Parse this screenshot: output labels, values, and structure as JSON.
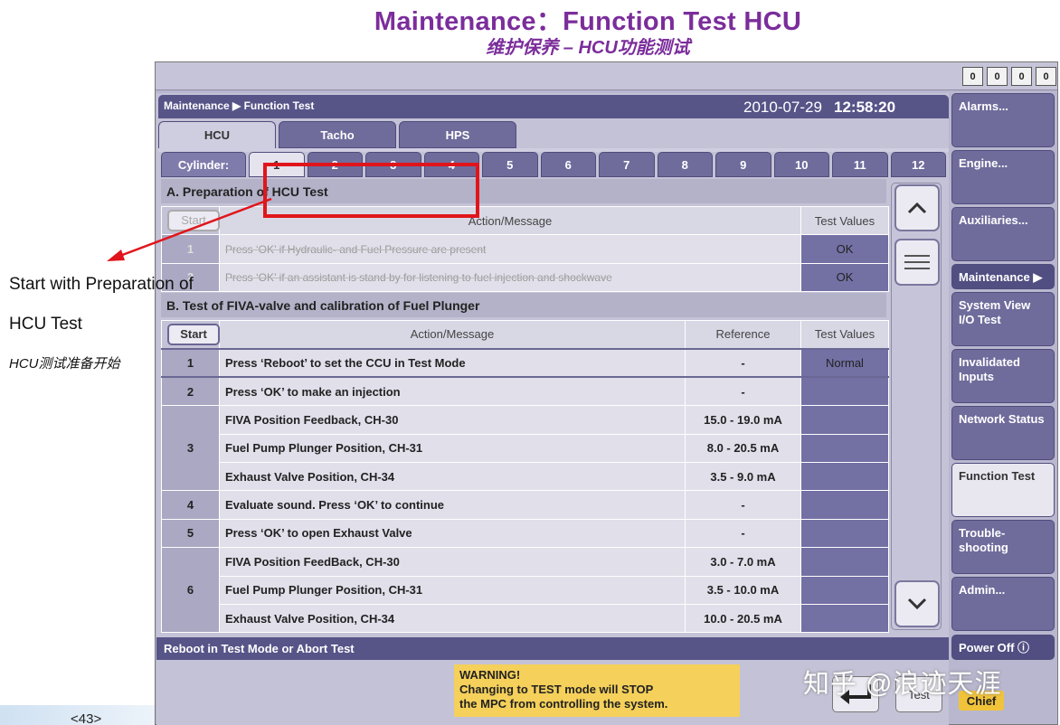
{
  "slide": {
    "title": "Maintenance：Function Test HCU",
    "subtitle": "维护保养 – HCU功能测试",
    "annotation_line1": "Start with Preparation of",
    "annotation_line2": "HCU Test",
    "annotation_zh": "HCU测试准备开始",
    "page_number": "<43>",
    "watermark": "知乎 @浪迹天涯"
  },
  "counters": [
    "0",
    "0",
    "0",
    "0"
  ],
  "header": {
    "breadcrumb": "Maintenance ▶ Function Test",
    "date": "2010-07-29",
    "time": "12:58:20"
  },
  "tabs": [
    "HCU",
    "Tacho",
    "HPS"
  ],
  "cylinder": {
    "label": "Cylinder:",
    "numbers": [
      "1",
      "2",
      "3",
      "4",
      "5",
      "6",
      "7",
      "8",
      "9",
      "10",
      "11",
      "12"
    ],
    "selected": "1"
  },
  "sectionA": {
    "title": "A. Preparation of HCU Test",
    "start": "Start",
    "col_action": "Action/Message",
    "col_values": "Test Values",
    "rows": [
      {
        "num": "1",
        "action": "Press ‘OK’ if Hydraulic- and Fuel Pressure are present",
        "value": "OK"
      },
      {
        "num": "2",
        "action": "Press ‘OK’ if an assistant is stand by for listening to fuel injection and shockwave",
        "value": "OK"
      }
    ]
  },
  "sectionB": {
    "title": "B. Test of FIVA-valve and calibration of Fuel Plunger",
    "start": "Start",
    "col_action": "Action/Message",
    "col_reference": "Reference",
    "col_values": "Test Values",
    "rows": [
      {
        "num": "1",
        "action": "Press ‘Reboot’ to set the CCU in Test Mode",
        "ref": "-",
        "value": "Normal"
      },
      {
        "num": "2",
        "action": "Press ‘OK’ to make an injection",
        "ref": "-",
        "value": ""
      },
      {
        "num": "3",
        "action": "FIVA Position Feedback, CH-30",
        "ref": "15.0 - 19.0 mA",
        "value": ""
      },
      {
        "num": "",
        "action": "Fuel Pump Plunger Position, CH-31",
        "ref": "8.0 - 20.5 mA",
        "value": ""
      },
      {
        "num": "",
        "action": "Exhaust Valve Position, CH-34",
        "ref": "3.5 - 9.0 mA",
        "value": ""
      },
      {
        "num": "4",
        "action": "Evaluate sound. Press ‘OK’ to continue",
        "ref": "-",
        "value": ""
      },
      {
        "num": "5",
        "action": "Press ‘OK’ to open Exhaust Valve",
        "ref": "-",
        "value": ""
      },
      {
        "num": "6",
        "action": "FIVA Position FeedBack, CH-30",
        "ref": "3.0 - 7.0 mA",
        "value": ""
      },
      {
        "num": "",
        "action": "Fuel Pump Plunger Position, CH-31",
        "ref": "3.5 - 10.0 mA",
        "value": ""
      },
      {
        "num": "",
        "action": "Exhaust Valve Position, CH-34",
        "ref": "10.0 - 20.5 mA",
        "value": ""
      }
    ]
  },
  "footer": {
    "status": "Reboot in Test Mode or Abort Test",
    "warning_title": "WARNING!",
    "warning_line1": "Changing to TEST mode will STOP",
    "warning_line2": "the MPC from controlling the system.",
    "test_label": "Test"
  },
  "sidebar": [
    {
      "label": "Alarms..."
    },
    {
      "label": "Engine..."
    },
    {
      "label": "Auxiliaries..."
    },
    {
      "label": "Maintenance ▶"
    },
    {
      "label": "System View I/O Test"
    },
    {
      "label": "Invalidated Inputs"
    },
    {
      "label": "Network Status"
    },
    {
      "label": "Function Test"
    },
    {
      "label": "Trouble-shooting"
    },
    {
      "label": "Admin..."
    },
    {
      "label": "Power Off ⓘ"
    }
  ],
  "chief": "Chief",
  "colors": {
    "accent": "#7b2d9b",
    "header": "#575488",
    "button": "#6f6c9c",
    "warning": "#f5d05a",
    "highlight": "#e0151b"
  }
}
